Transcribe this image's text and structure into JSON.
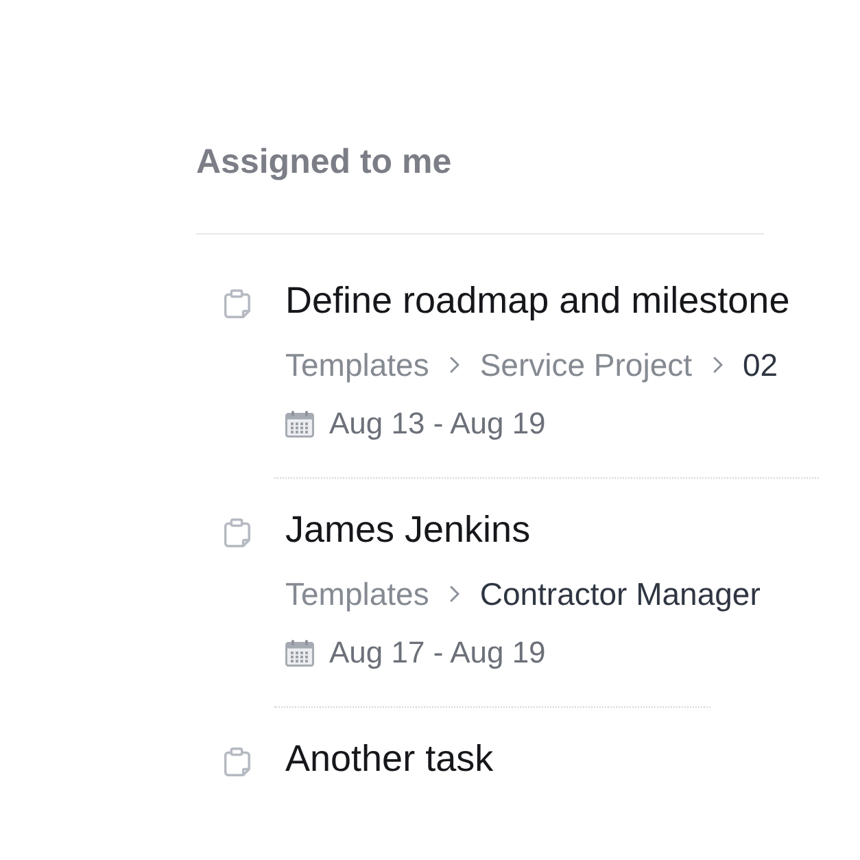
{
  "section": {
    "title": "Assigned to me"
  },
  "tasks": [
    {
      "title": "Define roadmap and milestone",
      "breadcrumb": [
        {
          "label": "Templates",
          "current": false
        },
        {
          "label": "Service Project",
          "current": false
        },
        {
          "label": "02",
          "current": true
        }
      ],
      "dates": "Aug 13 - Aug 19"
    },
    {
      "title": "James Jenkins",
      "breadcrumb": [
        {
          "label": "Templates",
          "current": false
        },
        {
          "label": "Contractor Manager",
          "current": true
        }
      ],
      "dates": "Aug 17 - Aug 19"
    },
    {
      "title": "Another task"
    }
  ]
}
